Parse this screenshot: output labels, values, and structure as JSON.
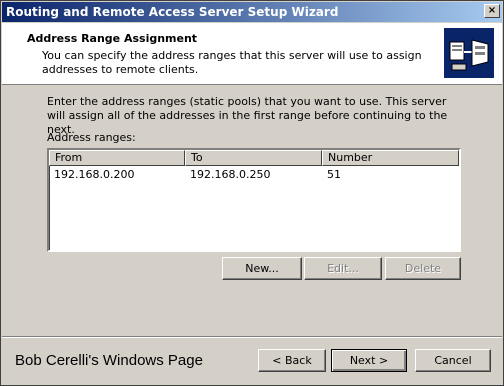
{
  "window": {
    "title": "Routing and Remote Access Server Setup Wizard",
    "close_glyph": "×"
  },
  "header": {
    "title": "Address Range Assignment",
    "subtitle": "You can specify the address ranges that this server will use to assign addresses to remote clients."
  },
  "body": {
    "intro": "Enter the address ranges (static pools) that you want to use. This server will assign all of the addresses in the first range before continuing to the next.",
    "ranges_label": "Address ranges:",
    "columns": [
      "From",
      "To",
      "Number"
    ],
    "rows": [
      {
        "from": "192.168.0.200",
        "to": "192.168.0.250",
        "number": "51"
      }
    ],
    "buttons": {
      "new": "New...",
      "edit": "Edit...",
      "delete": "Delete"
    }
  },
  "footer": {
    "caption": "Bob Cerelli's Windows Page",
    "back": "< Back",
    "next": "Next >",
    "cancel": "Cancel"
  }
}
